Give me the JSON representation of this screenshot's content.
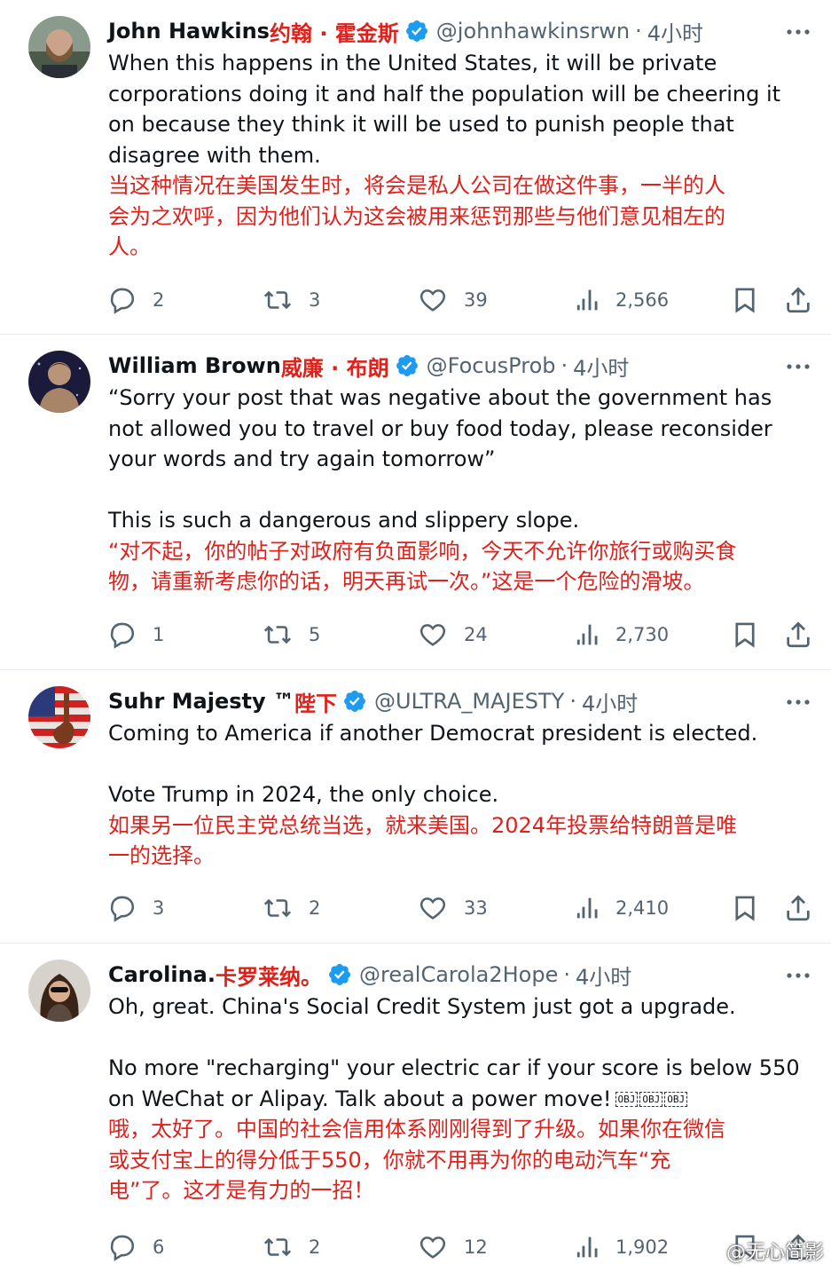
{
  "tweets": [
    {
      "name": "John Hawkins",
      "name_cn": "约翰 · 霍金斯",
      "handle": "@johnhawkinsrwn",
      "time": "4小时",
      "text_en": "When this happens in the United States, it will be private\ncorporations doing it and half the population will be cheering it\non because they think it will be used to punish people that\ndisagree with them.",
      "text_cn": "当这种情况在美国发生时，将会是私人公司在做这件事，一半的人\n会为之欢呼，因为他们认为这会被用来惩罚那些与他们意见相左的\n人。",
      "replies": "2",
      "retweets": "3",
      "likes": "39",
      "views": "2,566"
    },
    {
      "name": "William Brown",
      "name_cn": "威廉 · 布朗",
      "handle": "@FocusProb",
      "time": "4小时",
      "text_en": "“Sorry your post that was negative about the government has\nnot allowed you to travel or buy food today, please reconsider\nyour words and try again tomorrow”\n\nThis is such a dangerous and slippery slope.",
      "text_cn": "“对不起，你的帖子对政府有负面影响，今天不允许你旅行或购买食\n物，请重新考虑你的话，明天再试一次。”这是一个危险的滑坡。",
      "replies": "1",
      "retweets": "5",
      "likes": "24",
      "views": "2,730"
    },
    {
      "name": "Suhr Majesty ™",
      "name_cn": "陛下",
      "handle": "@ULTRA_MAJESTY",
      "time": "4小时",
      "text_en": "Coming to America if another Democrat president is elected.\n\nVote Trump in 2024, the only choice.",
      "text_cn": "如果另一位民主党总统当选，就来美国。2024年投票给特朗普是唯\n一的选择。",
      "replies": "3",
      "retweets": "2",
      "likes": "33",
      "views": "2,410"
    },
    {
      "name": "Carolina.",
      "name_cn": "卡罗莱纳。",
      "handle": "@realCarola2Hope",
      "time": "4小时",
      "text_en": "Oh, great. China's Social Credit System just got a upgrade.\n\nNo more \"recharging\" your electric car if your score is below 550\non WeChat or Alipay. Talk about a power move!",
      "obj_tags": [
        "OBJ",
        "OBJ",
        "OBJ"
      ],
      "text_cn": "哦，太好了。中国的社会信用体系刚刚得到了升级。如果你在微信\n或支付宝上的得分低于550，你就不用再为你的电动汽车“充\n电”了。这才是有力的一招！",
      "replies": "6",
      "retweets": "2",
      "likes": "12",
      "views": "1,902"
    }
  ],
  "watermark": "@无心简影",
  "colors": {
    "verified": "#1d9bf0",
    "cn_text": "#e0211b",
    "muted": "#536471"
  },
  "icons": [
    "reply-icon",
    "retweet-icon",
    "like-icon",
    "views-icon",
    "bookmark-icon",
    "share-icon",
    "more-icon",
    "verified-badge-icon"
  ]
}
